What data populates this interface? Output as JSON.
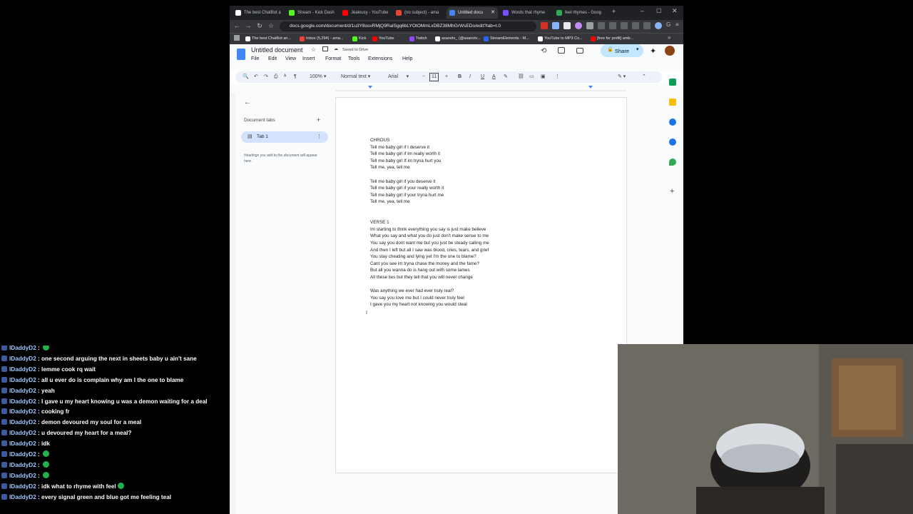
{
  "browser": {
    "tabs": [
      {
        "label": "The best ChatBot a",
        "active": false,
        "color": "#ffffff"
      },
      {
        "label": "Stream - Kick Dash",
        "active": false,
        "color": "#53fc18"
      },
      {
        "label": "Jealousy - YouTube",
        "active": false,
        "color": "#ff0000"
      },
      {
        "label": "(no subject) - ama",
        "active": false,
        "color": "#ea4335"
      },
      {
        "label": "Untitled docu",
        "active": true,
        "color": "#4285f4"
      },
      {
        "label": "Words that rhyme",
        "active": false,
        "color": "#7c4dff"
      },
      {
        "label": "feel rhymes - Goog",
        "active": false,
        "color": "#34a853"
      }
    ],
    "url": "docs.google.com/document/d/1u3Y8osvRMjQ9RalSgq6bLYOtOMmLxDBZ38MhGrWsEDo/edit?tab=t.0",
    "bookmarks": [
      {
        "label": "The best ChatBot an...",
        "color": "#ffffff"
      },
      {
        "label": "Inbox (5,294) - ama...",
        "color": "#ea4335"
      },
      {
        "label": "Kick",
        "color": "#53fc18"
      },
      {
        "label": "YouTube",
        "color": "#ff0000"
      },
      {
        "label": "Twitch",
        "color": "#9146ff"
      },
      {
        "label": "asanotv_ (@asanotv...",
        "color": "#ffffff"
      },
      {
        "label": "StreamElements - M...",
        "color": "#2b64f0"
      },
      {
        "label": "YouTube to MP3 Co...",
        "color": "#ffffff"
      },
      {
        "label": "[free for profit] amb...",
        "color": "#ff0000"
      }
    ]
  },
  "docs": {
    "title": "Untitled document",
    "saved": "Saved to Drive",
    "menu": [
      "File",
      "Edit",
      "View",
      "Insert",
      "Format",
      "Tools",
      "Extensions",
      "Help"
    ],
    "share": "Share",
    "zoom": "100%",
    "style": "Normal text",
    "font": "Arial",
    "font_size": "11",
    "sidebar": {
      "title": "Document tabs",
      "tab": "Tab 1",
      "hint": "Headings you add to the document will appear here."
    },
    "lines": [
      "CHROUS",
      "Tell me baby girl if I deserve it",
      "Tell me baby girl if Im really worth it",
      "Tell me baby girl If im tryna hurt you",
      "Tell me, yea, tell me",
      "",
      "Tell me baby girl if you deserve it",
      "Tell me baby girl if your really worth it",
      "Tell me baby girl if your tryna hurt me",
      "Tell me, yea, tell me",
      "",
      "",
      "VERSE 1",
      "Im starting to think everything you say is just make believe",
      "What you say and what you do just don't make sense to me",
      "You say you dont want me but you just be steady calling me",
      "And then I left but all I saw was blood, cries, tears, and grief",
      "You stay cheating and lying yet I'm the one to blame?",
      "Cant you see im tryna chase the money and the fame?",
      "But all you wanna do is hang out with some lames",
      "All these lies but they tell that you will never change",
      "",
      "Was anything we ever had ever truly real?",
      "You say you love me but I could never truly feel",
      "I gave you my heart not knowing you would steal"
    ]
  },
  "chat": [
    {
      "user": "IDaddyD2",
      "msg": "",
      "emote": true
    },
    {
      "user": "IDaddyD2",
      "msg": "one second arguing the next in sheets baby u ain't sane",
      "emote": false
    },
    {
      "user": "IDaddyD2",
      "msg": "lemme cook rq wait",
      "emote": false
    },
    {
      "user": "IDaddyD2",
      "msg": "all u ever do is complain why am I the one to blame",
      "emote": false
    },
    {
      "user": "IDaddyD2",
      "msg": "yeah",
      "emote": false
    },
    {
      "user": "IDaddyD2",
      "msg": "I gave u my heart knowing u was a demon waiting for a deal",
      "emote": false
    },
    {
      "user": "IDaddyD2",
      "msg": "cooking fr",
      "emote": false
    },
    {
      "user": "IDaddyD2",
      "msg": "demon devoured my soul for a meal",
      "emote": false
    },
    {
      "user": "IDaddyD2",
      "msg": "u devoured my heart for a meal?",
      "emote": false
    },
    {
      "user": "IDaddyD2",
      "msg": "idk",
      "emote": false
    },
    {
      "user": "IDaddyD2",
      "msg": "",
      "emote": true
    },
    {
      "user": "IDaddyD2",
      "msg": "",
      "emote": true
    },
    {
      "user": "IDaddyD2",
      "msg": "",
      "emote": true
    },
    {
      "user": "IDaddyD2",
      "msg": "idk what to rhyme with feel",
      "emote": true
    },
    {
      "user": "IDaddyD2",
      "msg": "every signal green and blue got me feeling teal",
      "emote": false
    }
  ]
}
